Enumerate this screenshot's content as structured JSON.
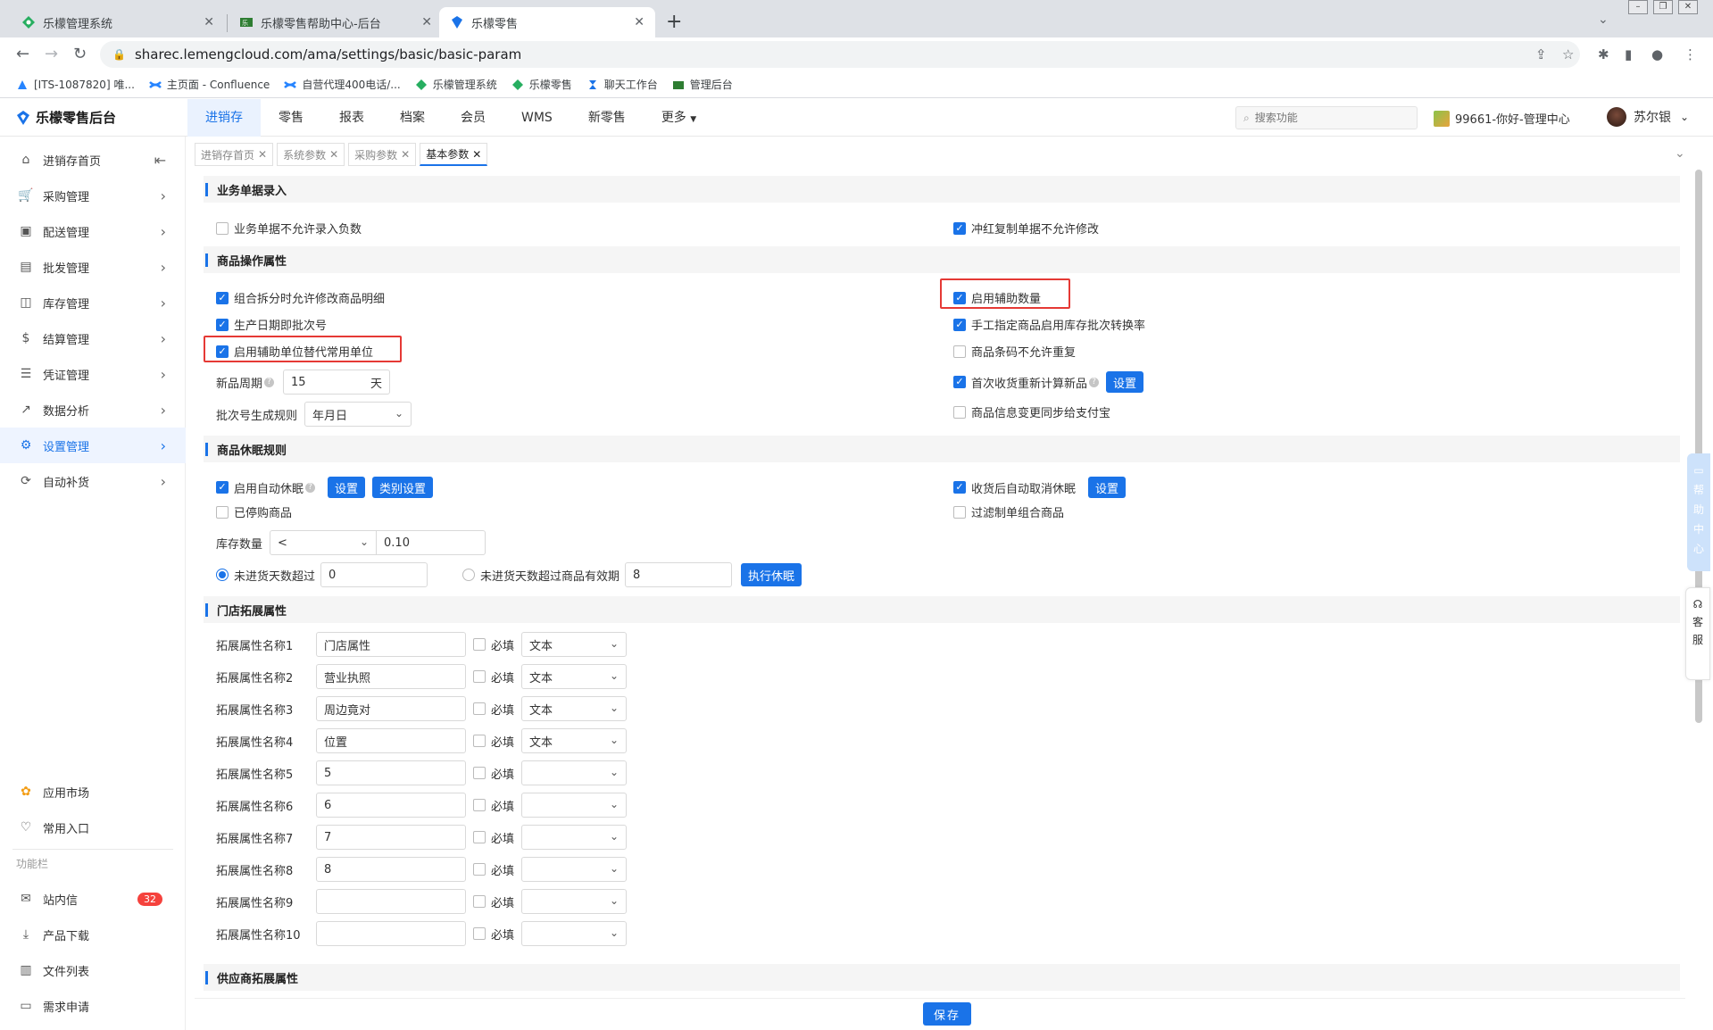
{
  "browser": {
    "tabs": [
      {
        "title": "乐檬管理系统"
      },
      {
        "title": "乐檬零售帮助中心-后台"
      },
      {
        "title": "乐檬零售"
      }
    ],
    "url": "sharec.lemengcloud.com/ama/settings/basic/basic-param",
    "bookmarks": [
      "[ITS-1087820] 唯...",
      "主页面 - Confluence",
      "自营代理400电话/...",
      "乐檬管理系统",
      "乐檬零售",
      "聊天工作台",
      "管理后台"
    ]
  },
  "app": {
    "logo": "乐檬零售后台",
    "topnav": [
      "进销存",
      "零售",
      "报表",
      "档案",
      "会员",
      "WMS",
      "新零售",
      "更多"
    ],
    "search_placeholder": "搜索功能",
    "store": "99661-你好-管理中心",
    "user": "苏尔银"
  },
  "sidebar": {
    "items": [
      "进销存首页",
      "采购管理",
      "配送管理",
      "批发管理",
      "库存管理",
      "结算管理",
      "凭证管理",
      "数据分析",
      "设置管理",
      "自动补货"
    ],
    "bottom": [
      "应用市场",
      "常用入口"
    ],
    "section_label": "功能栏",
    "func": [
      "站内信",
      "产品下载",
      "文件列表",
      "需求申请"
    ],
    "unread": "32"
  },
  "page_tabs": [
    "进销存首页",
    "系统参数",
    "采购参数",
    "基本参数"
  ],
  "sections": {
    "s1": "业务单据录入",
    "s2": "商品操作属性",
    "s3": "商品休眠规则",
    "s4": "门店拓展属性",
    "s5": "供应商拓展属性"
  },
  "s1": {
    "left": "业务单据不允许录入负数",
    "right": "冲红复制单据不允许修改"
  },
  "s2": {
    "a": "组合拆分时允许修改商品明细",
    "b": "生产日期即批次号",
    "c": "启用辅助单位替代常用单位",
    "new_cycle_label": "新品周期",
    "new_cycle_value": "15",
    "new_cycle_unit": "天",
    "batch_rule_label": "批次号生成规则",
    "batch_rule_value": "年月日",
    "d": "启用辅助数量",
    "e": "手工指定商品启用库存批次转换率",
    "f": "商品条码不允许重复",
    "g": "首次收货重新计算新品",
    "g_btn": "设置",
    "h": "商品信息变更同步给支付宝"
  },
  "s3": {
    "auto_sleep": "启用自动休眠",
    "btn_set": "设置",
    "btn_cat": "类别设置",
    "stopped": "已停购商品",
    "stock_label": "库存数量",
    "stock_op": "<",
    "stock_value": "0.10",
    "radio1": "未进货天数超过",
    "radio1_value": "0",
    "radio2": "未进货天数超过商品有效期",
    "radio2_value": "8",
    "exec_btn": "执行休眠",
    "cancel_after": "收货后自动取消休眠",
    "cancel_btn": "设置",
    "filter": "过滤制单组合商品"
  },
  "s4": {
    "required_label": "必填",
    "rows": [
      {
        "label": "拓展属性名称1",
        "value": "门店属性",
        "type": "文本"
      },
      {
        "label": "拓展属性名称2",
        "value": "营业执照",
        "type": "文本"
      },
      {
        "label": "拓展属性名称3",
        "value": "周边竟对",
        "type": "文本"
      },
      {
        "label": "拓展属性名称4",
        "value": "位置",
        "type": "文本"
      },
      {
        "label": "拓展属性名称5",
        "value": "5",
        "type": ""
      },
      {
        "label": "拓展属性名称6",
        "value": "6",
        "type": ""
      },
      {
        "label": "拓展属性名称7",
        "value": "7",
        "type": ""
      },
      {
        "label": "拓展属性名称8",
        "value": "8",
        "type": ""
      },
      {
        "label": "拓展属性名称9",
        "value": "",
        "type": ""
      },
      {
        "label": "拓展属性名称10",
        "value": "",
        "type": ""
      }
    ]
  },
  "right_widgets": {
    "help": [
      "帮",
      "助",
      "中",
      "心"
    ],
    "service": [
      "客",
      "服"
    ]
  },
  "save": "保存"
}
